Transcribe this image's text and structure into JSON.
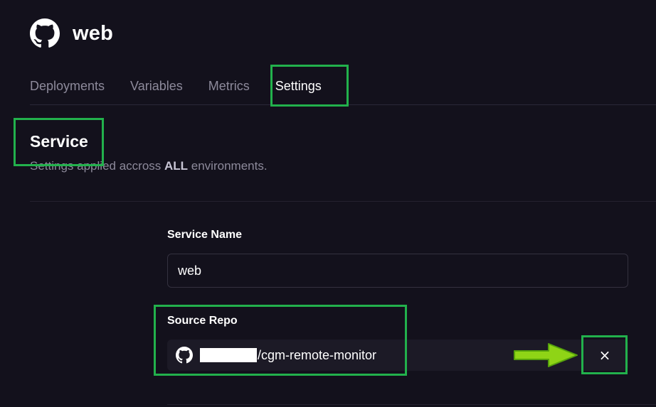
{
  "header": {
    "icon": "github-icon",
    "title": "web"
  },
  "tabs": [
    {
      "label": "Deployments",
      "active": false
    },
    {
      "label": "Variables",
      "active": false
    },
    {
      "label": "Metrics",
      "active": false
    },
    {
      "label": "Settings",
      "active": true
    }
  ],
  "section": {
    "title": "Service",
    "subtitle_prefix": "Settings applied accross ",
    "subtitle_bold": "ALL",
    "subtitle_suffix": " environments."
  },
  "service_name": {
    "label": "Service Name",
    "value": "web"
  },
  "source_repo": {
    "label": "Source Repo",
    "icon": "github-icon",
    "repo_name": "/cgm-remote-monitor",
    "disconnect_label": "×"
  },
  "colors": {
    "background": "#13111c",
    "highlight": "#22b14c",
    "arrow": "#8fd416"
  }
}
